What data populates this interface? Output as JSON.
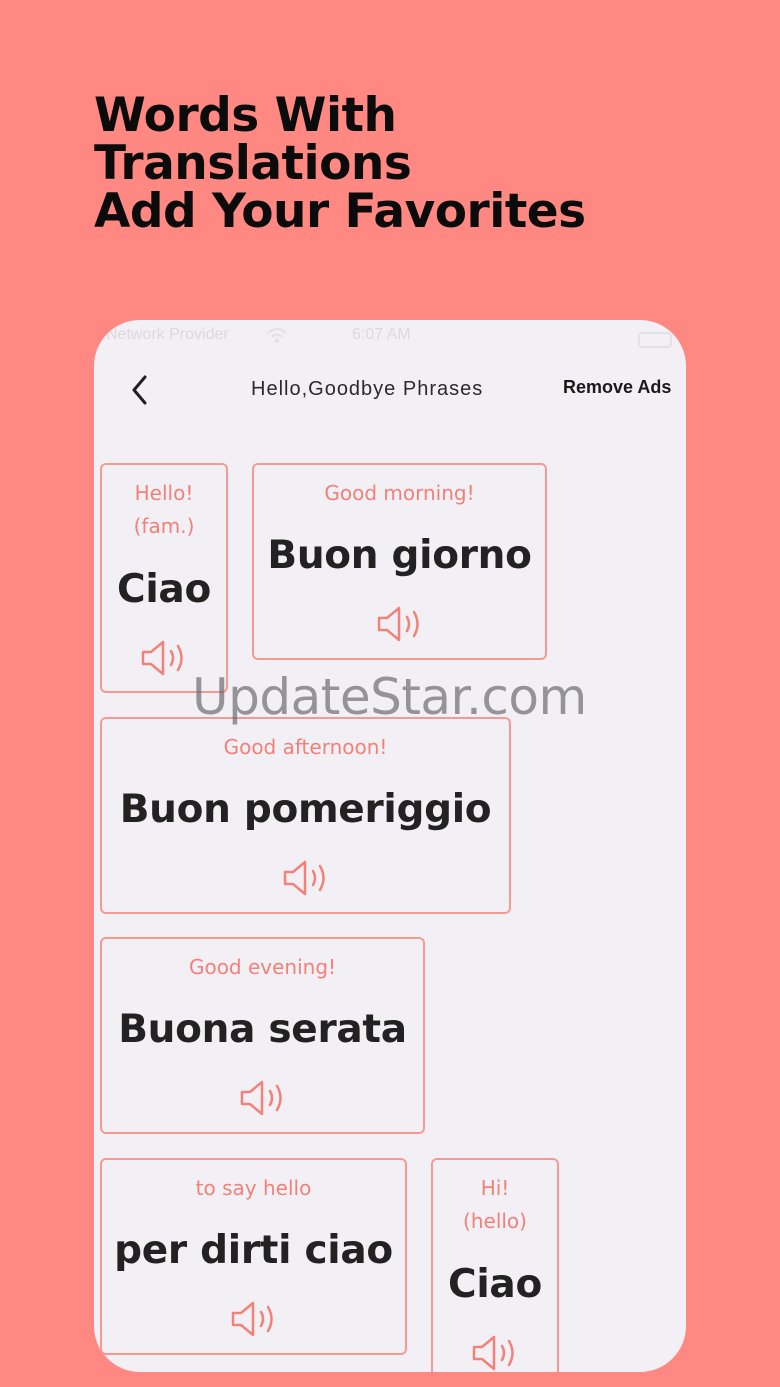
{
  "headline": {
    "line1": "Words With",
    "line2": "Translations",
    "line3": "Add Your Favorites"
  },
  "status_bar": {
    "carrier": "Network Provider",
    "time": "6:07 AM"
  },
  "nav": {
    "title": "Hello,Goodbye Phrases",
    "remove_ads": "Remove Ads"
  },
  "cards": [
    {
      "translation": "Hello!\n(fam.)",
      "word": "Ciao"
    },
    {
      "translation": "Good morning!",
      "word": "Buon giorno"
    },
    {
      "translation": "Good afternoon!",
      "word": "Buon pomeriggio"
    },
    {
      "translation": "Good evening!",
      "word": "Buona serata"
    },
    {
      "translation": "to say hello",
      "word": "per dirti ciao"
    },
    {
      "translation": "Hi!\n(hello)",
      "word": "Ciao"
    }
  ],
  "watermark": "UpdateStar.com",
  "colors": {
    "background": "#FF8982",
    "phone_screen": "#F2F0F4",
    "card_border": "#F59A93",
    "translation_text": "#F2817A",
    "word_text": "#222222"
  },
  "icons": {
    "back": "chevron-left-icon",
    "speaker": "speaker-icon"
  }
}
